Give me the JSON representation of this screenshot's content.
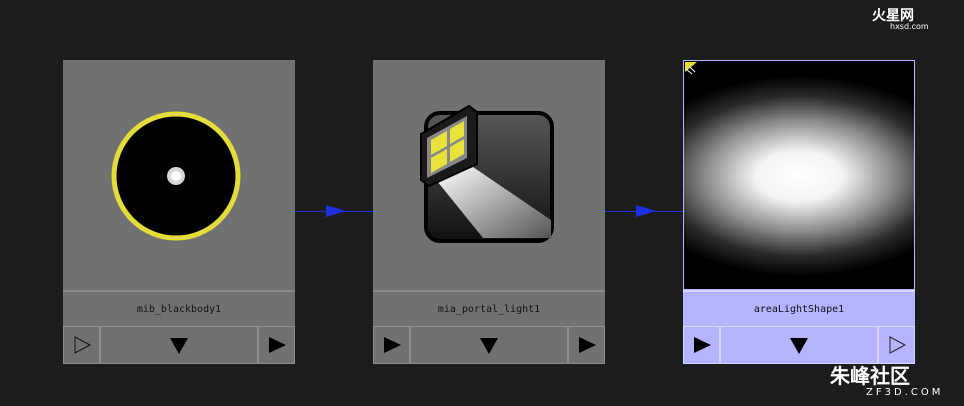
{
  "nodes": [
    {
      "name": "mib_blackbody1",
      "icon": "blackbody-icon",
      "selected": false
    },
    {
      "name": "mia_portal_light1",
      "icon": "portal-light-icon",
      "selected": false
    },
    {
      "name": "areaLightShape1",
      "icon": "area-light-preview",
      "selected": true
    }
  ],
  "watermarks": {
    "top": {
      "logo": "火星网",
      "site": "hxsd.com"
    },
    "bottom": {
      "logo": "朱峰社区",
      "site": "ZF3D.COM"
    }
  },
  "colors": {
    "background": "#1c1c1c",
    "node": "#717171",
    "selected": "#b4b4ff",
    "connection": "#1d2fe0"
  }
}
